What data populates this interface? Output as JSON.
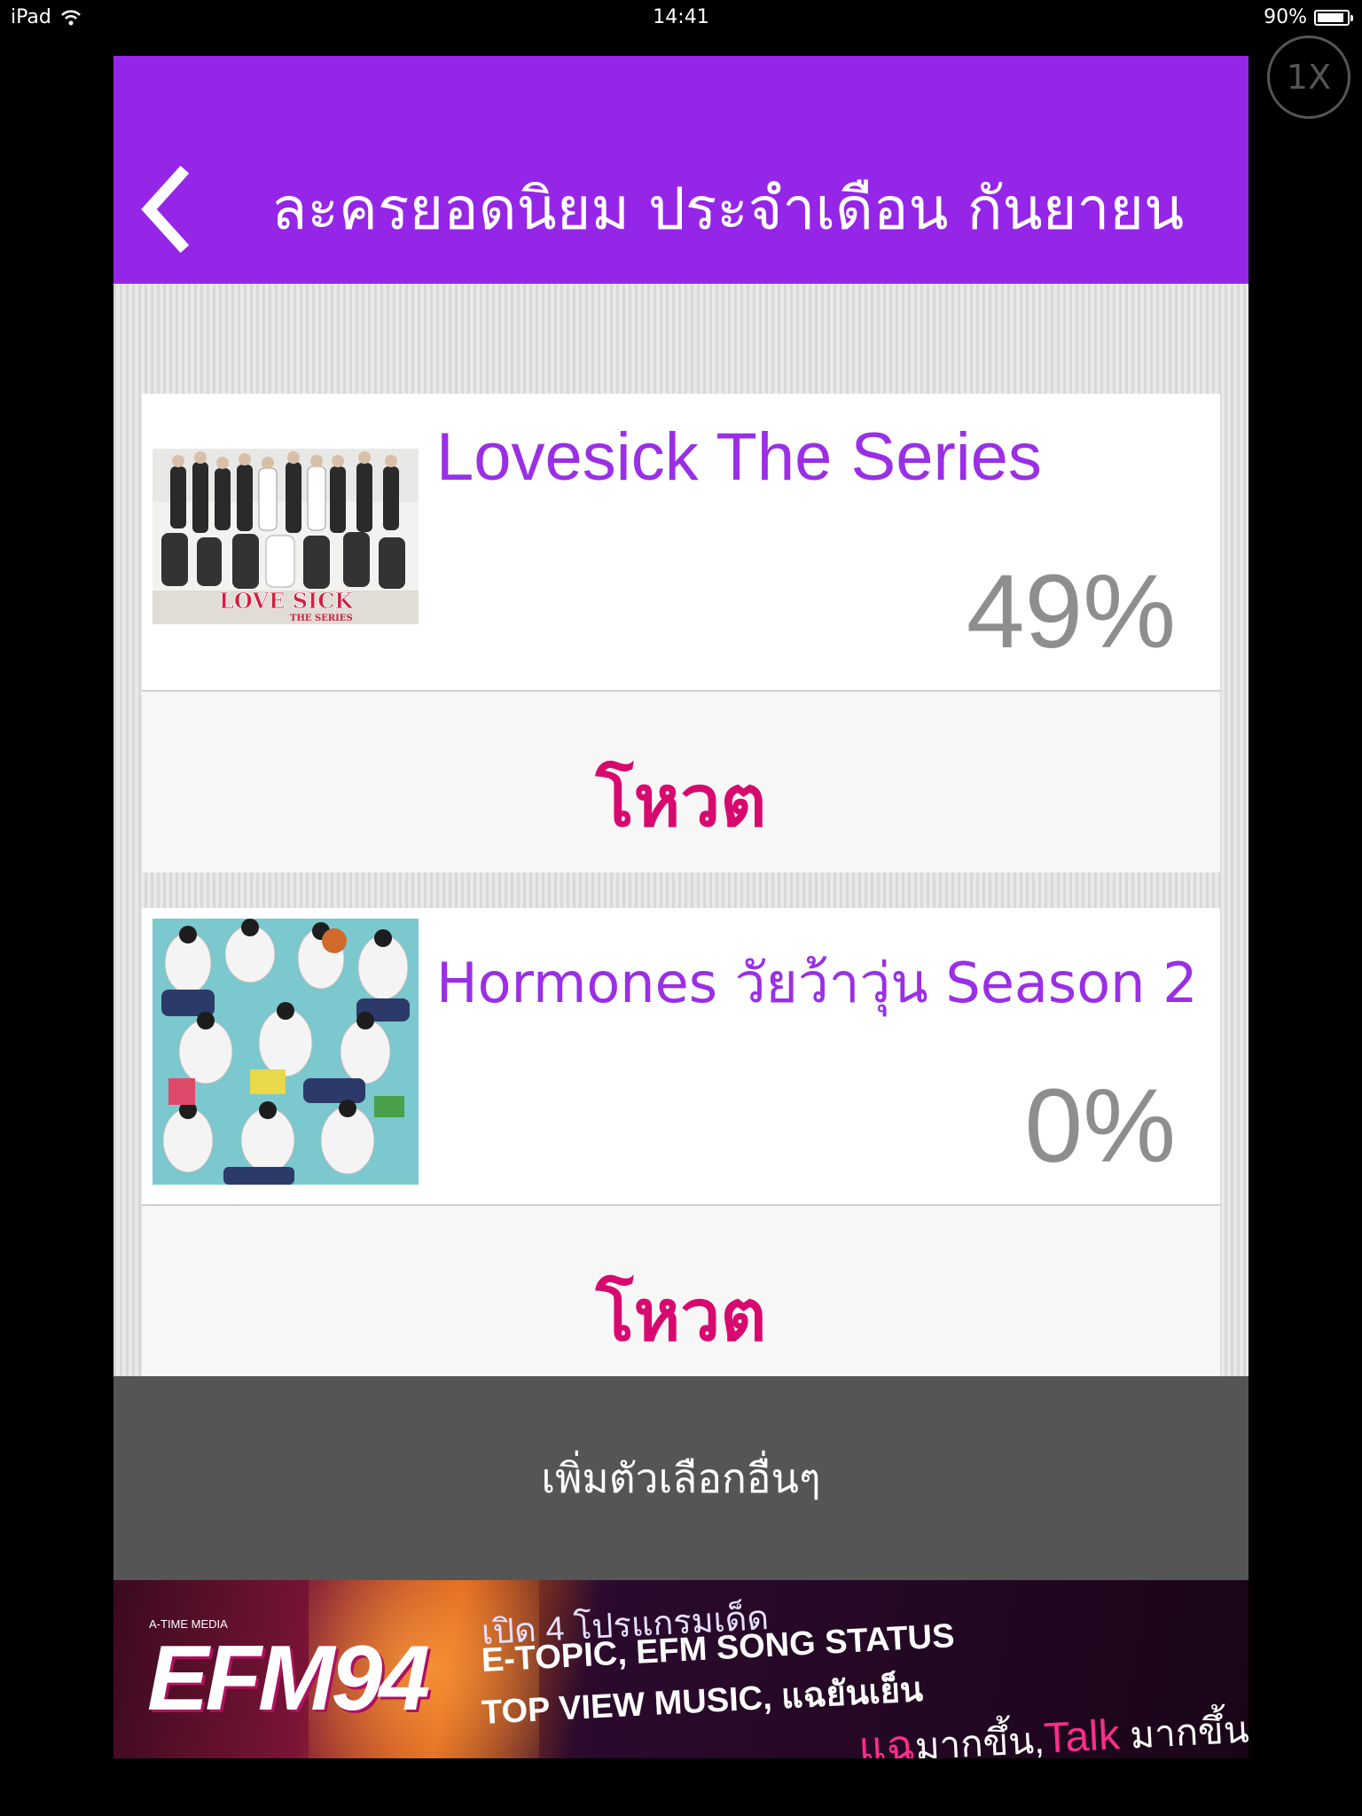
{
  "status_bar": {
    "device": "iPad",
    "time": "14:41",
    "battery_text": "90%",
    "battery_level": 0.9
  },
  "zoom_button": {
    "label": "1X"
  },
  "header": {
    "title": "ละครยอดนิยม ประจำเดือน กันยายน"
  },
  "colors": {
    "header_bg": "#9526e8",
    "title_purple": "#9a2fe6",
    "vote_pink": "#d8096e",
    "percent_gray": "#8e8e8e",
    "add_bar_bg": "#555555"
  },
  "items": [
    {
      "title": "Lovesick The Series",
      "percent": "49%",
      "vote_label": "โหวต",
      "thumb_caption": "LOVE SICK",
      "thumb_subcaption": "THE SERIES"
    },
    {
      "title": "Hormones วัยว้าวุ่น Season 2",
      "percent": "0%",
      "vote_label": "โหวต"
    }
  ],
  "add_options": {
    "label": "เพิ่มตัวเลือกอื่นๆ"
  },
  "banner": {
    "media": "A-TIME MEDIA",
    "logo": "EFM94",
    "line1": "เปิด 4 โปรแกรมเด็ด",
    "line2": "E-TOPIC, EFM SONG STATUS",
    "line3": "TOP VIEW MUSIC, แฉยันเย็น",
    "line4_a": "แฉ",
    "line4_b": "มากขึ้น,",
    "line4_c": "Talk",
    "line4_d": " มากขึ้น"
  }
}
